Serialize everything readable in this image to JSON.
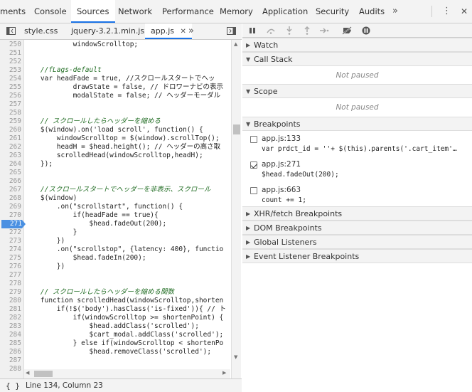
{
  "devtools": {
    "tabs": [
      {
        "label": "ments"
      },
      {
        "label": "Console"
      },
      {
        "label": "Sources"
      },
      {
        "label": "Network"
      },
      {
        "label": "Performance"
      },
      {
        "label": "Memory"
      },
      {
        "label": "Application"
      },
      {
        "label": "Security"
      },
      {
        "label": "Audits"
      }
    ],
    "active_tab": "Sources",
    "more_tabs_glyph": "»",
    "menu_glyph": "⋮",
    "close_glyph": "✕"
  },
  "editor": {
    "file_tabs": [
      {
        "label": "style.css"
      },
      {
        "label": "jquery-3.2.1.min.js"
      },
      {
        "label": "app.js"
      }
    ],
    "active_file": "app.js",
    "tab_close_glyph": "✕",
    "more_files_glyph": "»",
    "lines": [
      {
        "n": "250",
        "text": "            windowScrolltop;"
      },
      {
        "n": "251",
        "text": ""
      },
      {
        "n": "252",
        "text": ""
      },
      {
        "n": "253",
        "text": "    //fLags-default"
      },
      {
        "n": "254",
        "text": "    var headFade = true, //スクロールスタートでヘッ"
      },
      {
        "n": "255",
        "text": "            drawState = false, // ドロワーナビの表示"
      },
      {
        "n": "256",
        "text": "            modalState = false; // ヘッダーモーダル"
      },
      {
        "n": "257",
        "text": ""
      },
      {
        "n": "258",
        "text": ""
      },
      {
        "n": "259",
        "text": "    // スクロールしたらヘッダーを縮める"
      },
      {
        "n": "260",
        "text": "    $(window).on('load scroll', function() {"
      },
      {
        "n": "261",
        "text": "        windowScrolltop = $(window).scrollTop();"
      },
      {
        "n": "262",
        "text": "        headH = $head.height(); // ヘッダーの高さ取"
      },
      {
        "n": "263",
        "text": "        scrolledHead(windowScrolltop,headH);"
      },
      {
        "n": "264",
        "text": "    });"
      },
      {
        "n": "265",
        "text": ""
      },
      {
        "n": "266",
        "text": ""
      },
      {
        "n": "267",
        "text": "    //スクロールスタートでヘッダーを非表示、スクロール"
      },
      {
        "n": "268",
        "text": "    $(window)"
      },
      {
        "n": "269",
        "text": "        .on(\"scrollstart\", function() {"
      },
      {
        "n": "270",
        "text": "            if(headFade == true){"
      },
      {
        "n": "271",
        "text": "                $head.fadeOut(200);"
      },
      {
        "n": "272",
        "text": "            }"
      },
      {
        "n": "273",
        "text": "        })"
      },
      {
        "n": "274",
        "text": "        .on(\"scrollstop\", {latency: 400}, functio"
      },
      {
        "n": "275",
        "text": "            $head.fadeIn(200);"
      },
      {
        "n": "276",
        "text": "        })"
      },
      {
        "n": "277",
        "text": ""
      },
      {
        "n": "278",
        "text": ""
      },
      {
        "n": "279",
        "text": "    // スクロールしたらヘッダーを縮める関数"
      },
      {
        "n": "280",
        "text": "    function scrolledHead(windowScrolltop,shorten"
      },
      {
        "n": "281",
        "text": "        if(!$('body').hasClass('is-fixed')){ // ト"
      },
      {
        "n": "282",
        "text": "            if(windowScrolltop >= shortenPoint) {"
      },
      {
        "n": "283",
        "text": "                $head.addClass('scrolled');"
      },
      {
        "n": "284",
        "text": "                $cart_modal.addClass('scrolled');"
      },
      {
        "n": "285",
        "text": "            } else if(windowScrolltop < shortenPo"
      },
      {
        "n": "286",
        "text": "                $head.removeClass('scrolled');"
      },
      {
        "n": "287",
        "text": ""
      },
      {
        "n": "288",
        "text": ""
      }
    ],
    "status": "Line 134, Column 23",
    "format_glyph": "{ }"
  },
  "debugger": {
    "sections": {
      "watch": "Watch",
      "call_stack": "Call Stack",
      "scope": "Scope",
      "breakpoints": "Breakpoints",
      "xhr": "XHR/fetch Breakpoints",
      "dom": "DOM Breakpoints",
      "global": "Global Listeners",
      "event": "Event Listener Breakpoints"
    },
    "not_paused": "Not paused",
    "breakpoints": [
      {
        "file": "app.js:133",
        "code": "var prdct_id = ''+ $(this).parents('.cart_item'…",
        "checked": false
      },
      {
        "file": "app.js:271",
        "code": "$head.fadeOut(200);",
        "checked": true
      },
      {
        "file": "app.js:663",
        "code": "count += 1;",
        "checked": false
      }
    ]
  }
}
